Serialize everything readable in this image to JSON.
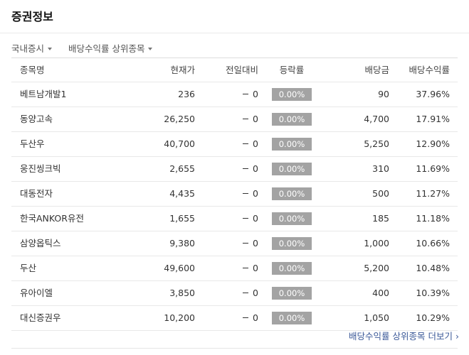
{
  "page_title": "증권정보",
  "filters": [
    {
      "label": "국내증시"
    },
    {
      "label": "배당수익률 상위종목"
    }
  ],
  "table": {
    "headers": {
      "name": "종목명",
      "price": "현재가",
      "change": "전일대비",
      "rate": "등락률",
      "dividend": "배당금",
      "yield": "배당수익률"
    },
    "rows": [
      {
        "name": "베트남개발1",
        "price": "236",
        "change": "0",
        "rate": "0.00%",
        "dividend": "90",
        "yield": "37.96%"
      },
      {
        "name": "동양고속",
        "price": "26,250",
        "change": "0",
        "rate": "0.00%",
        "dividend": "4,700",
        "yield": "17.91%"
      },
      {
        "name": "두산우",
        "price": "40,700",
        "change": "0",
        "rate": "0.00%",
        "dividend": "5,250",
        "yield": "12.90%"
      },
      {
        "name": "웅진씽크빅",
        "price": "2,655",
        "change": "0",
        "rate": "0.00%",
        "dividend": "310",
        "yield": "11.69%"
      },
      {
        "name": "대동전자",
        "price": "4,435",
        "change": "0",
        "rate": "0.00%",
        "dividend": "500",
        "yield": "11.27%"
      },
      {
        "name": "한국ANKOR유전",
        "price": "1,655",
        "change": "0",
        "rate": "0.00%",
        "dividend": "185",
        "yield": "11.18%"
      },
      {
        "name": "삼양옵틱스",
        "price": "9,380",
        "change": "0",
        "rate": "0.00%",
        "dividend": "1,000",
        "yield": "10.66%"
      },
      {
        "name": "두산",
        "price": "49,600",
        "change": "0",
        "rate": "0.00%",
        "dividend": "5,200",
        "yield": "10.48%"
      },
      {
        "name": "유아이엘",
        "price": "3,850",
        "change": "0",
        "rate": "0.00%",
        "dividend": "400",
        "yield": "10.39%"
      },
      {
        "name": "대신증권우",
        "price": "10,200",
        "change": "0",
        "rate": "0.00%",
        "dividend": "1,050",
        "yield": "10.29%"
      }
    ]
  },
  "more_link": "배당수익률 상위종목 더보기",
  "icons": {
    "dropdown": "caret-down-icon",
    "more": "chevron-right-icon",
    "unchanged": "dash-icon"
  },
  "colors": {
    "rate_box": "#a3a3a3",
    "link": "#3b5998"
  }
}
